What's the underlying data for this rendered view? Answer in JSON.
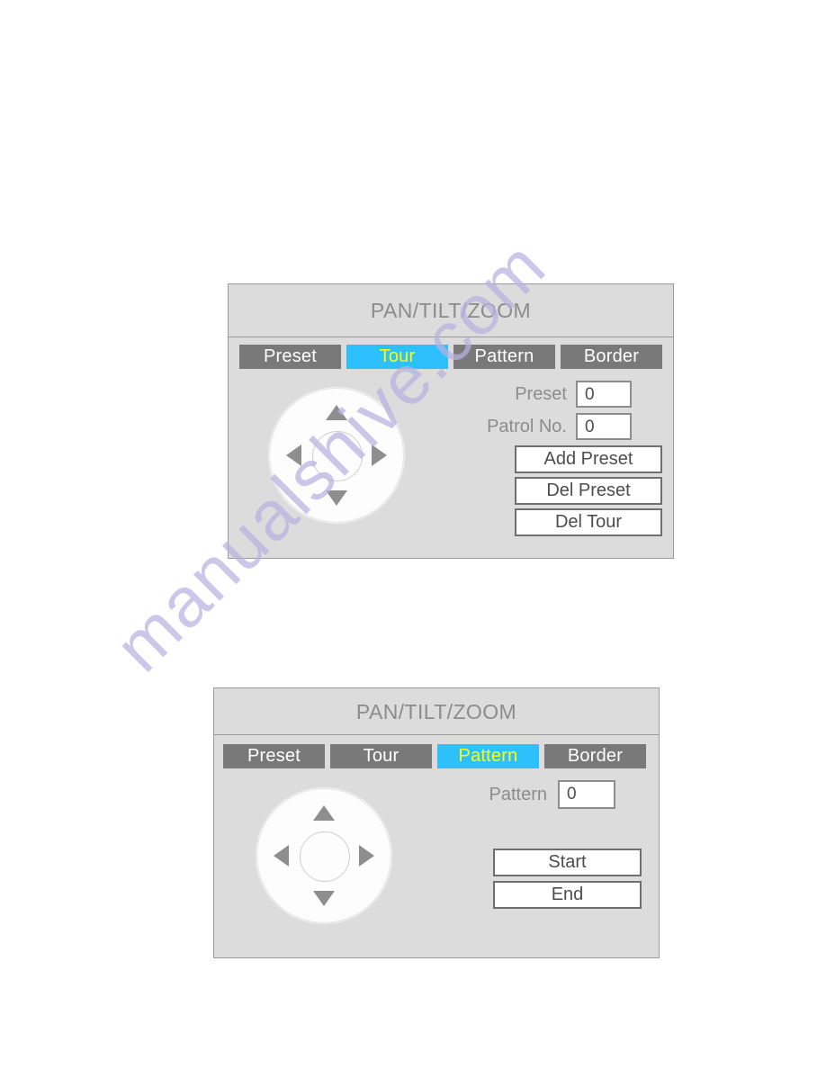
{
  "watermark": {
    "text": "manualshive.com"
  },
  "colors": {
    "panel_bg": "#dcdcdc",
    "tab_inactive_bg": "#797979",
    "tab_active_bg": "#2ec0fd",
    "tab_active_text": "#ffff00",
    "label_text": "#8c8c8c",
    "button_bg": "#ffffff"
  },
  "panels": [
    {
      "title": "PAN/TILT/ZOOM",
      "tabs": [
        {
          "label": "Preset",
          "active": false
        },
        {
          "label": "Tour",
          "active": true
        },
        {
          "label": "Pattern",
          "active": false
        },
        {
          "label": "Border",
          "active": false
        }
      ],
      "dpad": {
        "up": "arrow-up-icon",
        "down": "arrow-down-icon",
        "left": "arrow-left-icon",
        "right": "arrow-right-icon",
        "center": "dpad-center"
      },
      "fields": [
        {
          "label": "Preset",
          "value": "0"
        },
        {
          "label": "Patrol No.",
          "value": "0"
        }
      ],
      "buttons": [
        {
          "label": "Add Preset"
        },
        {
          "label": "Del Preset"
        },
        {
          "label": "Del Tour"
        }
      ]
    },
    {
      "title": "PAN/TILT/ZOOM",
      "tabs": [
        {
          "label": "Preset",
          "active": false
        },
        {
          "label": "Tour",
          "active": false
        },
        {
          "label": "Pattern",
          "active": true
        },
        {
          "label": "Border",
          "active": false
        }
      ],
      "dpad": {
        "up": "arrow-up-icon",
        "down": "arrow-down-icon",
        "left": "arrow-left-icon",
        "right": "arrow-right-icon",
        "center": "dpad-center"
      },
      "fields": [
        {
          "label": "Pattern",
          "value": "0"
        }
      ],
      "buttons": [
        {
          "label": "Start"
        },
        {
          "label": "End"
        }
      ]
    }
  ]
}
